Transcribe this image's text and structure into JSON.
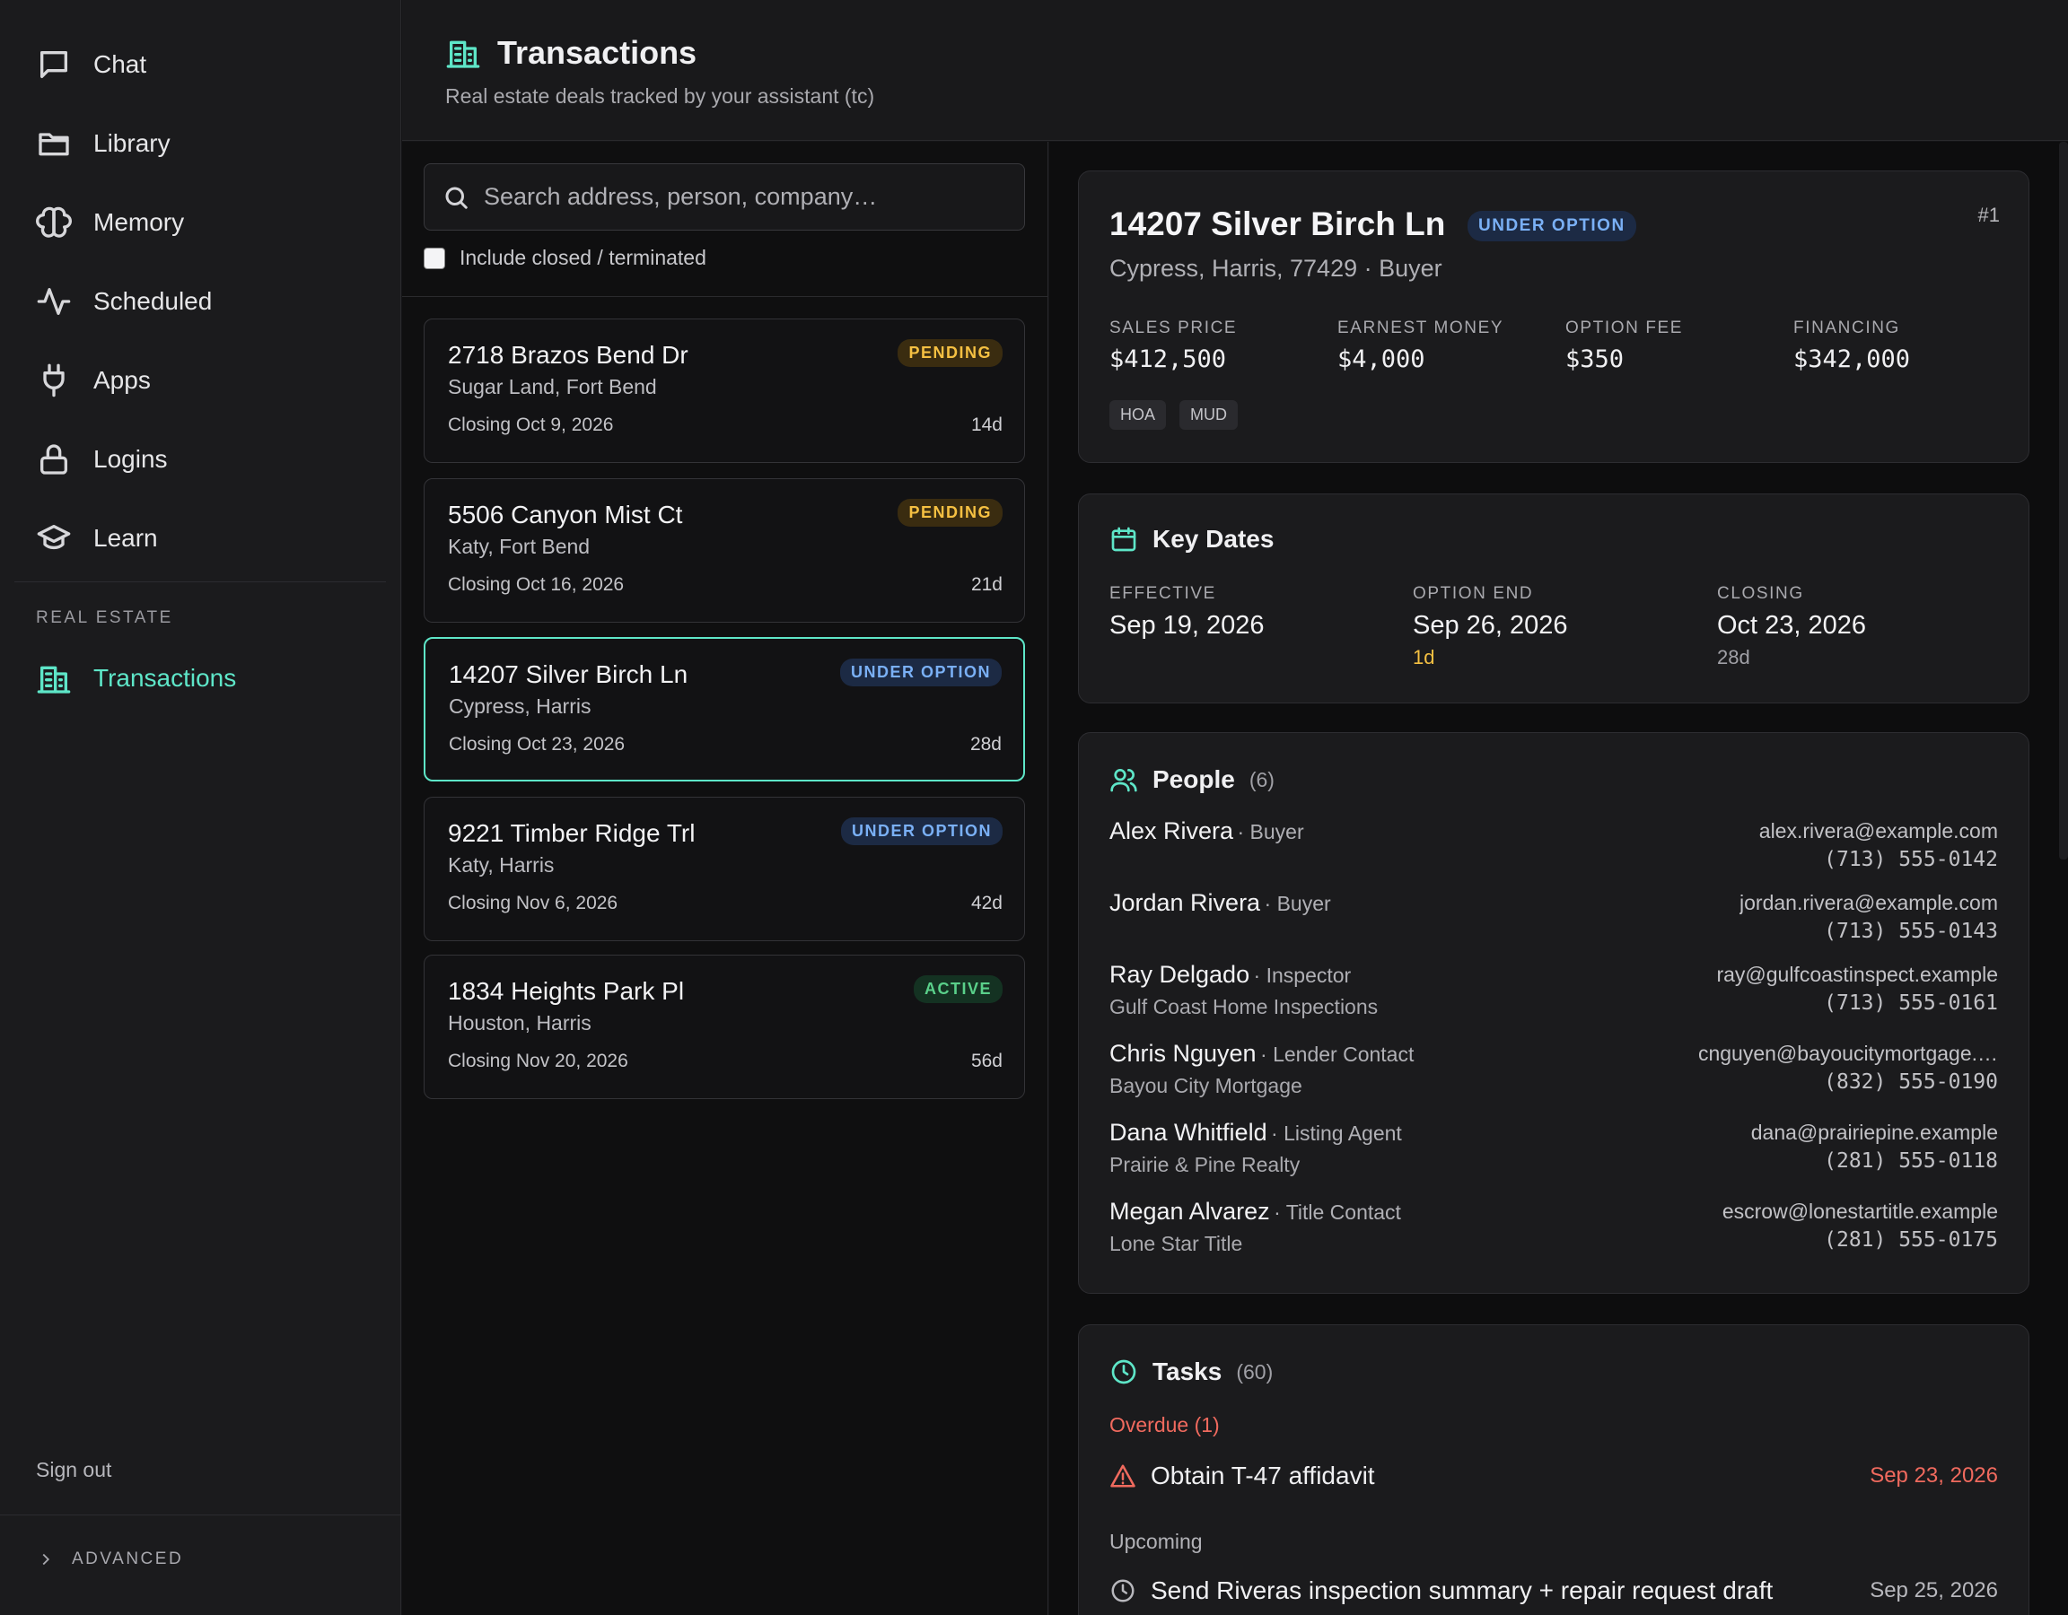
{
  "sidebar": {
    "items": [
      {
        "label": "Chat",
        "icon": "chat-icon"
      },
      {
        "label": "Library",
        "icon": "folder-icon"
      },
      {
        "label": "Memory",
        "icon": "brain-icon"
      },
      {
        "label": "Scheduled",
        "icon": "activity-icon"
      },
      {
        "label": "Apps",
        "icon": "plug-icon"
      },
      {
        "label": "Logins",
        "icon": "lock-icon"
      },
      {
        "label": "Learn",
        "icon": "graduation-cap-icon"
      }
    ],
    "section_label": "REAL ESTATE",
    "transactions_label": "Transactions",
    "signout_label": "Sign out",
    "advanced_label": "ADVANCED"
  },
  "header": {
    "title": "Transactions",
    "subtitle": "Real estate deals tracked by your assistant (tc)"
  },
  "list": {
    "search_placeholder": "Search address, person, company…",
    "include_closed_label": "Include closed / terminated",
    "include_closed_checked": false,
    "cards": [
      {
        "address": "2718 Brazos Bend Dr",
        "city": "Sugar Land, Fort Bend",
        "closing": "Closing Oct 9, 2026",
        "days": "14d",
        "status": "PENDING",
        "status_kind": "pending"
      },
      {
        "address": "5506 Canyon Mist Ct",
        "city": "Katy, Fort Bend",
        "closing": "Closing Oct 16, 2026",
        "days": "21d",
        "status": "PENDING",
        "status_kind": "pending"
      },
      {
        "address": "14207 Silver Birch Ln",
        "city": "Cypress, Harris",
        "closing": "Closing Oct 23, 2026",
        "days": "28d",
        "status": "UNDER OPTION",
        "status_kind": "option",
        "selected": true
      },
      {
        "address": "9221 Timber Ridge Trl",
        "city": "Katy, Harris",
        "closing": "Closing Nov 6, 2026",
        "days": "42d",
        "status": "UNDER OPTION",
        "status_kind": "option"
      },
      {
        "address": "1834 Heights Park Pl",
        "city": "Houston, Harris",
        "closing": "Closing Nov 20, 2026",
        "days": "56d",
        "status": "ACTIVE",
        "status_kind": "active"
      }
    ]
  },
  "detail": {
    "address": "14207 Silver Birch Ln",
    "status": "UNDER OPTION",
    "number": "#1",
    "location": "Cypress, Harris, 77429",
    "side": "· Buyer",
    "stats": [
      {
        "label": "SALES PRICE",
        "value": "$412,500"
      },
      {
        "label": "EARNEST MONEY",
        "value": "$4,000"
      },
      {
        "label": "OPTION FEE",
        "value": "$350"
      },
      {
        "label": "FINANCING",
        "value": "$342,000"
      }
    ],
    "tags": [
      "HOA",
      "MUD"
    ],
    "key_dates": {
      "title": "Key Dates",
      "dates": [
        {
          "label": "EFFECTIVE",
          "value": "Sep 19, 2026",
          "sub": ""
        },
        {
          "label": "OPTION END",
          "value": "Sep 26, 2026",
          "sub": "1d"
        },
        {
          "label": "CLOSING",
          "value": "Oct 23, 2026",
          "sub": "28d"
        }
      ]
    },
    "people": {
      "title": "People",
      "count": "(6)",
      "list": [
        {
          "name": "Alex Rivera",
          "role": "· Buyer",
          "company": "",
          "email": "alex.rivera@example.com",
          "phone": "(713) 555-0142"
        },
        {
          "name": "Jordan Rivera",
          "role": "· Buyer",
          "company": "",
          "email": "jordan.rivera@example.com",
          "phone": "(713) 555-0143"
        },
        {
          "name": "Ray Delgado",
          "role": "· Inspector",
          "company": "Gulf Coast Home Inspections",
          "email": "ray@gulfcoastinspect.example",
          "phone": "(713) 555-0161"
        },
        {
          "name": "Chris Nguyen",
          "role": "· Lender Contact",
          "company": "Bayou City Mortgage",
          "email": "cnguyen@bayoucitymortgage.…",
          "phone": "(832) 555-0190"
        },
        {
          "name": "Dana Whitfield",
          "role": "· Listing Agent",
          "company": "Prairie & Pine Realty",
          "email": "dana@prairiepine.example",
          "phone": "(281) 555-0118"
        },
        {
          "name": "Megan Alvarez",
          "role": "· Title Contact",
          "company": "Lone Star Title",
          "email": "escrow@lonestartitle.example",
          "phone": "(281) 555-0175"
        }
      ]
    },
    "tasks": {
      "title": "Tasks",
      "count": "(60)",
      "overdue_label": "Overdue (1)",
      "overdue": [
        {
          "name": "Obtain T-47 affidavit",
          "date": "Sep 23, 2026"
        }
      ],
      "upcoming_label": "Upcoming",
      "upcoming": [
        {
          "name": "Send Riveras inspection summary + repair request draft",
          "date": "Sep 25, 2026"
        }
      ]
    }
  },
  "colors": {
    "accent": "#5ee6c8",
    "pending": "#f5c042",
    "option": "#7ab0f5",
    "active": "#5ad08a",
    "danger": "#f06a5e"
  }
}
